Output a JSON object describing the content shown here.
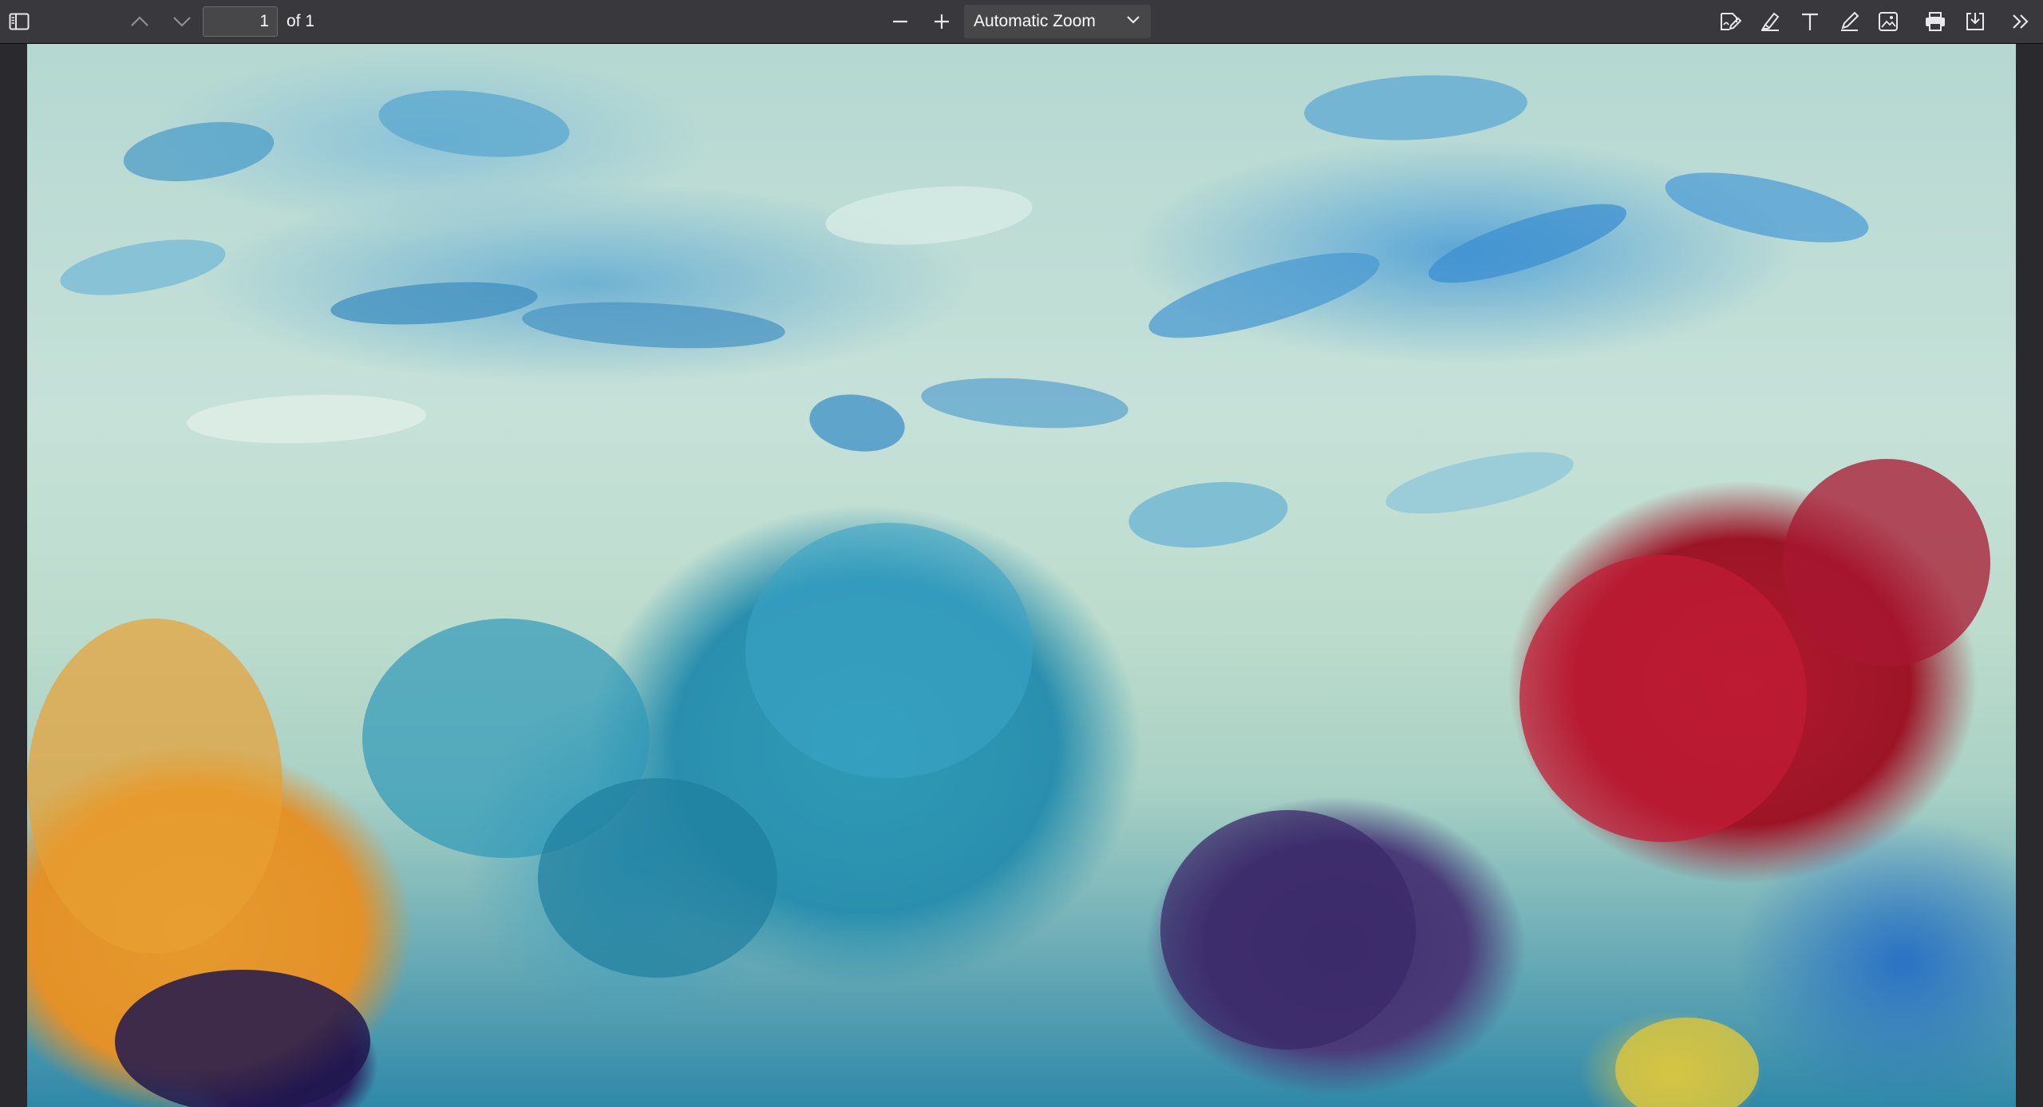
{
  "toolbar": {
    "sidebar_toggle_icon": "sidebar-icon",
    "previous_page_icon": "chevron-up-icon",
    "next_page_icon": "chevron-down-icon",
    "page_number": "1",
    "page_count_label": "of 1",
    "zoom_out_icon": "minus-icon",
    "zoom_in_icon": "plus-icon",
    "zoom_value": "Automatic Zoom",
    "right_tools": [
      "edit-pdf-icon",
      "highlight-icon",
      "text-icon",
      "draw-icon",
      "image-icon",
      "print-icon",
      "save-icon",
      "more-tools-icon"
    ]
  },
  "document": {
    "content": "painting-image"
  },
  "colors": {
    "toolbar_bg": "#38383d",
    "viewer_bg": "#2a2a2e",
    "text": "#f9f9fa"
  }
}
